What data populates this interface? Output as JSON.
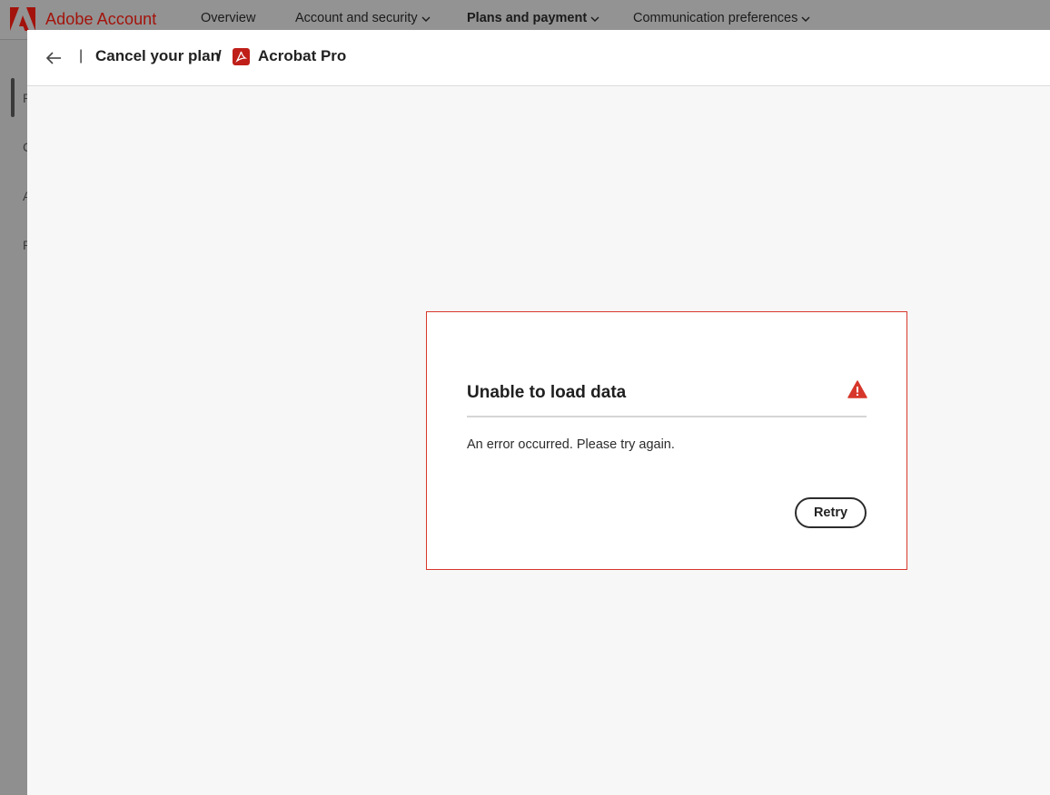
{
  "nav": {
    "brand": "Adobe Account",
    "items": [
      {
        "label": "Overview",
        "has_menu": false
      },
      {
        "label": "Account and security",
        "has_menu": true
      },
      {
        "label": "Plans and payment",
        "has_menu": true,
        "active": true
      },
      {
        "label": "Communication preferences",
        "has_menu": true
      }
    ]
  },
  "sidebar": {
    "letters": [
      "P",
      "C",
      "A",
      "P"
    ]
  },
  "header": {
    "back_icon": "arrow-left-icon",
    "separator": "|",
    "title": "Cancel your plan",
    "slash": "/",
    "product_icon": "acrobat-icon",
    "product": "Acrobat Pro"
  },
  "error_card": {
    "title": "Unable to load data",
    "icon": "alert-triangle-icon",
    "message": "An error occurred. Please try again.",
    "retry_label": "Retry"
  },
  "colors": {
    "brand_red": "#a3130b",
    "error_border": "#d7372b",
    "warning_red": "#d7372b"
  }
}
